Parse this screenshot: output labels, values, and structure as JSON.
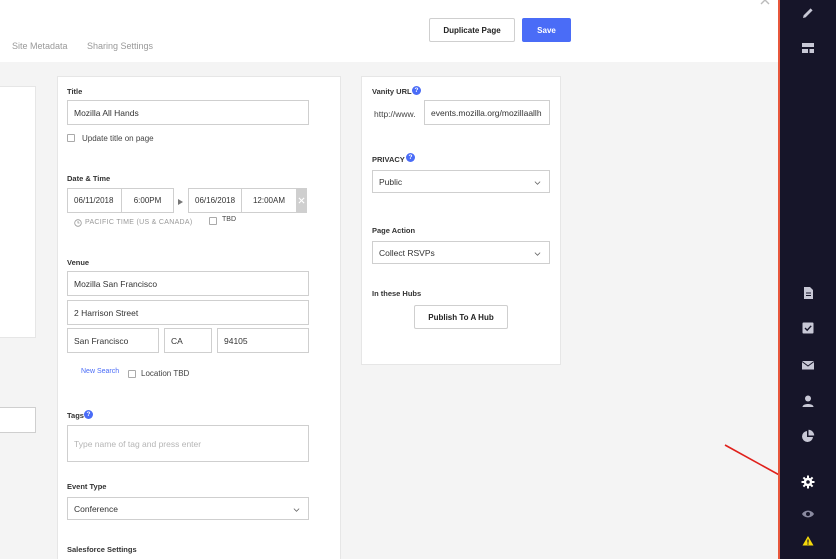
{
  "header": {
    "tabs": [
      {
        "label": "Site Metadata"
      },
      {
        "label": "Sharing Settings"
      }
    ],
    "duplicate_label": "Duplicate Page",
    "save_label": "Save"
  },
  "main": {
    "title_label": "Title",
    "title_value": "Mozilla All Hands",
    "update_title_label": "Update title on page",
    "datetime_label": "Date & Time",
    "start_date": "06/11/2018",
    "start_time": "6:00PM",
    "end_date": "06/16/2018",
    "end_time": "12:00AM",
    "timezone": "PACIFIC TIME (US & CANADA)",
    "tbd_label": "TBD",
    "venue_label": "Venue",
    "venue_name": "Mozilla San Francisco",
    "venue_street": "2 Harrison Street",
    "venue_city": "San Francisco",
    "venue_state": "CA",
    "venue_zip": "94105",
    "new_search_label": "New Search",
    "location_tbd_label": "Location TBD",
    "tags_label": "Tags",
    "tags_placeholder": "Type name of tag and press enter",
    "event_type_label": "Event Type",
    "event_type_value": "Conference",
    "salesforce_label": "Salesforce Settings"
  },
  "right": {
    "vanity_label": "Vanity URL",
    "vanity_prefix": "http://www.",
    "vanity_value": "events.mozilla.org/mozillaallh",
    "privacy_label": "PRIVACY",
    "privacy_value": "Public",
    "page_action_label": "Page Action",
    "page_action_value": "Collect RSVPs",
    "hubs_label": "In these Hubs",
    "publish_label": "Publish To A Hub"
  },
  "help_glyph": "?",
  "colors": {
    "accent": "#4a6cf7",
    "sidebar": "#161529",
    "sidebar_border": "#e8573c",
    "annotation_arrow": "#e0201b"
  },
  "sidebar_icons": [
    "pencil-icon",
    "layout-icon",
    "document-icon",
    "checklist-icon",
    "mail-icon",
    "person-icon",
    "pie-chart-icon",
    "gear-icon",
    "eye-icon",
    "warning-icon"
  ]
}
